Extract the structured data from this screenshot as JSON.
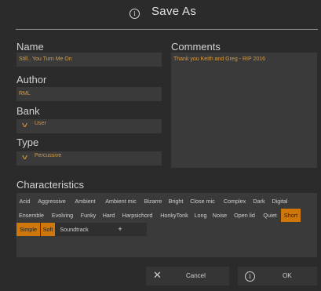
{
  "dialog": {
    "title": "Save As",
    "title_icon": "info-icon"
  },
  "form": {
    "name_label": "Name",
    "name_value": "Still.. You Turn Me On",
    "author_label": "Author",
    "author_value": "RML",
    "bank_label": "Bank",
    "bank_value": "User",
    "type_label": "Type",
    "type_value": "Percussive",
    "comments_label": "Comments",
    "comments_value": "Thank you Keith and Greg - RIP 2016"
  },
  "characteristics": {
    "label": "Characteristics",
    "tags": [
      {
        "label": "Acid",
        "selected": false
      },
      {
        "label": "Aggressive",
        "selected": false
      },
      {
        "label": "Ambient",
        "selected": false
      },
      {
        "label": "Ambient mic",
        "selected": false
      },
      {
        "label": "Bizarre",
        "selected": false
      },
      {
        "label": "Bright",
        "selected": false
      },
      {
        "label": "Close mic",
        "selected": false
      },
      {
        "label": "Complex",
        "selected": false
      },
      {
        "label": "Dark",
        "selected": false
      },
      {
        "label": "Digital",
        "selected": false
      },
      {
        "label": "Ensemble",
        "selected": false
      },
      {
        "label": "Evolving",
        "selected": false
      },
      {
        "label": "Funky",
        "selected": false
      },
      {
        "label": "Hard",
        "selected": false
      },
      {
        "label": "Harpsichord",
        "selected": false
      },
      {
        "label": "HonkyTonk",
        "selected": false
      },
      {
        "label": "Long",
        "selected": false
      },
      {
        "label": "Noise",
        "selected": false
      },
      {
        "label": "Open lid",
        "selected": false
      },
      {
        "label": "Quiet",
        "selected": false
      },
      {
        "label": "Short",
        "selected": true
      },
      {
        "label": "Simple",
        "selected": true
      },
      {
        "label": "Soft",
        "selected": true
      },
      {
        "label": "Soundtrack",
        "selected": false
      }
    ],
    "add_label": "+"
  },
  "buttons": {
    "cancel_label": "Cancel",
    "cancel_icon": "close-icon",
    "ok_label": "OK",
    "ok_icon": "info-icon"
  },
  "colors": {
    "accent": "#d0770c",
    "value_text": "#d89a3a",
    "background": "#2b2b2b",
    "field": "#3a3a3a"
  }
}
